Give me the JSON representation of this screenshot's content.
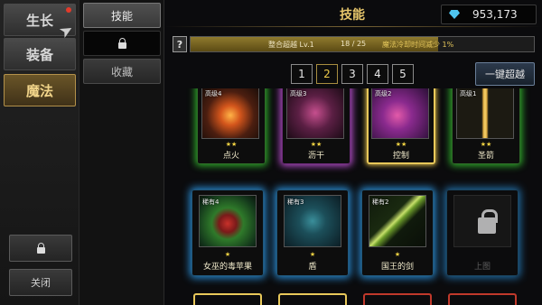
{
  "sidebar": {
    "items": [
      {
        "label": "生长",
        "active": false,
        "notify": true
      },
      {
        "label": "装备",
        "active": false
      },
      {
        "label": "魔法",
        "active": true
      }
    ],
    "close_label": "关闭"
  },
  "subtabs": [
    {
      "label": "技能",
      "active": true
    },
    {
      "label": "",
      "locked": true
    },
    {
      "label": "收藏"
    }
  ],
  "header": {
    "title": "技能",
    "currency": "953,173"
  },
  "progress": {
    "label": "整合超越 Lv.1",
    "count": "18 / 25",
    "note": "魔法冷却时间减少 1%",
    "fraction": 0.72
  },
  "pages": [
    "1",
    "2",
    "3",
    "4",
    "5"
  ],
  "active_page": "2",
  "confirm_label": "一键超越",
  "cards": [
    {
      "rarity": "高级4",
      "stars": "★★",
      "name": "点火",
      "glow": "g"
    },
    {
      "rarity": "高级3",
      "stars": "★★",
      "name": "沥干",
      "glow": "p"
    },
    {
      "rarity": "高级2",
      "stars": "★★",
      "name": "控制",
      "glow": "y"
    },
    {
      "rarity": "高级1",
      "stars": "★★",
      "name": "圣箭",
      "glow": "g"
    },
    {
      "rarity": "稀有4",
      "stars": "★",
      "name": "女巫的毒苹果",
      "glow": "b"
    },
    {
      "rarity": "稀有3",
      "stars": "★",
      "name": "盾",
      "glow": "b"
    },
    {
      "rarity": "稀有2",
      "stars": "★",
      "name": "国王的剑",
      "glow": "b"
    },
    {
      "rarity": "",
      "stars": "",
      "name": "上图",
      "glow": "b",
      "locked": true
    }
  ],
  "colors": {
    "accent": "#e7c66b",
    "rare_glow": "#2a8fd8",
    "advanced_glow": "#2ea82a"
  }
}
